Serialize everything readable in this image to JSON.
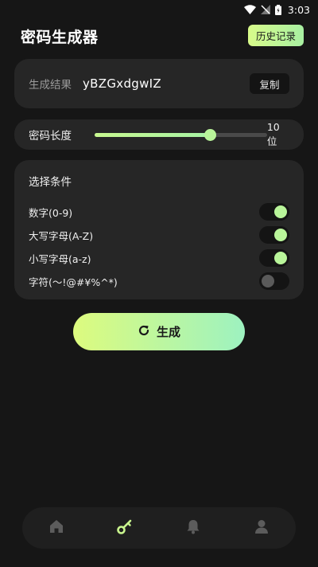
{
  "status_bar": {
    "time": "3:03"
  },
  "header": {
    "title": "密码生成器",
    "history_label": "历史记录"
  },
  "result": {
    "label": "生成结果",
    "value": "yBZGxdgwIZ",
    "copy_label": "复制"
  },
  "length": {
    "label": "密码长度",
    "value_text": "10位",
    "slider_fraction": 0.67
  },
  "options": {
    "title": "选择条件",
    "items": [
      {
        "label": "数字(0-9)",
        "enabled": true
      },
      {
        "label": "大写字母(A-Z)",
        "enabled": true
      },
      {
        "label": "小写字母(a-z)",
        "enabled": true
      },
      {
        "label": "字符(〜!@#¥%^*)",
        "enabled": false
      }
    ]
  },
  "generate": {
    "label": "生成",
    "icon": "refresh-icon"
  },
  "nav": {
    "items": [
      {
        "icon": "home-icon",
        "active": false
      },
      {
        "icon": "key-icon",
        "active": true
      },
      {
        "icon": "bell-icon",
        "active": false
      },
      {
        "icon": "user-icon",
        "active": false
      }
    ]
  },
  "colors": {
    "background": "#161616",
    "card": "#262626",
    "accent": "#b9f59a",
    "accent_gradient_start": "#ddfb7e",
    "accent_gradient_end": "#9df2c0",
    "inactive_icon": "#5c5c5c"
  }
}
